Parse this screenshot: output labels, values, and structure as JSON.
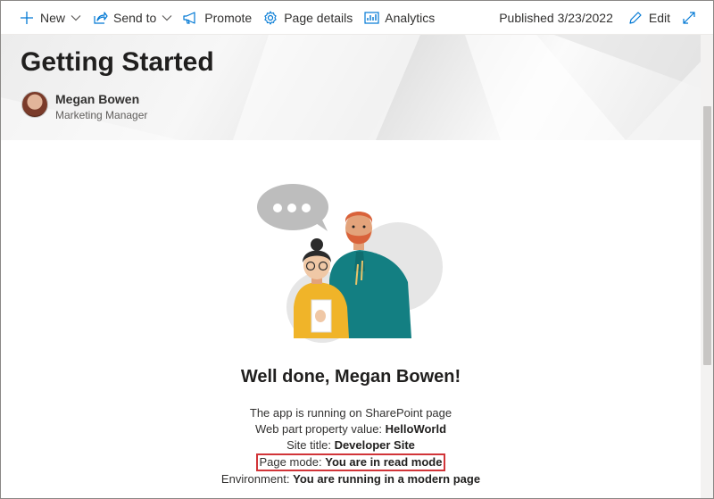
{
  "command_bar": {
    "new_label": "New",
    "send_to_label": "Send to",
    "promote_label": "Promote",
    "page_details_label": "Page details",
    "analytics_label": "Analytics",
    "published": "Published 3/23/2022",
    "edit_label": "Edit"
  },
  "header": {
    "title": "Getting Started",
    "author_name": "Megan Bowen",
    "author_role": "Marketing Manager"
  },
  "webpart": {
    "welcome": "Well done, Megan Bowen!",
    "line1": "The app is running on SharePoint page",
    "property_prefix": "Web part property value: ",
    "property_value": "HelloWorld",
    "site_prefix": "Site title: ",
    "site_value": "Developer Site",
    "mode_prefix": "Page mode: ",
    "mode_value": "You are in read mode",
    "env_prefix": "Environment: ",
    "env_value": "You are running in a modern page"
  }
}
